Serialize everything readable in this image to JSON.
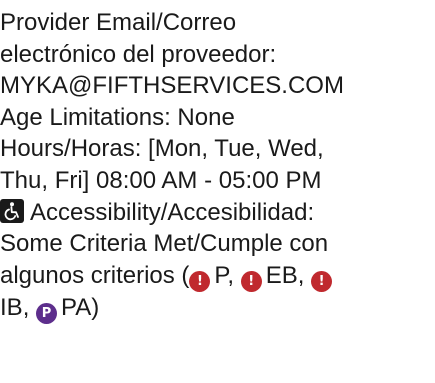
{
  "provider_email": {
    "label_line1": "Provider Email/Correo",
    "label_line2": "electrónico del proveedor:",
    "value": "MYKA@FIFTHSERVICES.COM"
  },
  "age_limitations": {
    "text": "Age Limitations: None"
  },
  "hours": {
    "line1": "Hours/Horas: [Mon, Tue, Wed,",
    "line2": "Thu, Fri] 08:00 AM - 05:00 PM"
  },
  "accessibility": {
    "icon": "wheelchair-icon",
    "line1": "Accessibility/Accesibilidad:",
    "line2": "Some Criteria Met/Cumple con",
    "line3_prefix": "algunos criterios (",
    "badges": [
      {
        "icon": "exclamation-circle-icon",
        "glyph": "!",
        "color": "#c0292e",
        "label": "P"
      },
      {
        "icon": "exclamation-circle-icon",
        "glyph": "!",
        "color": "#c0292e",
        "label": "EB"
      },
      {
        "icon": "exclamation-circle-icon",
        "glyph": "!",
        "color": "#c0292e",
        "label": "IB"
      },
      {
        "icon": "parking-circle-icon",
        "glyph": "P",
        "color": "#5d2e8c",
        "label": "PA"
      }
    ],
    "sep": ", ",
    "close": ")"
  }
}
